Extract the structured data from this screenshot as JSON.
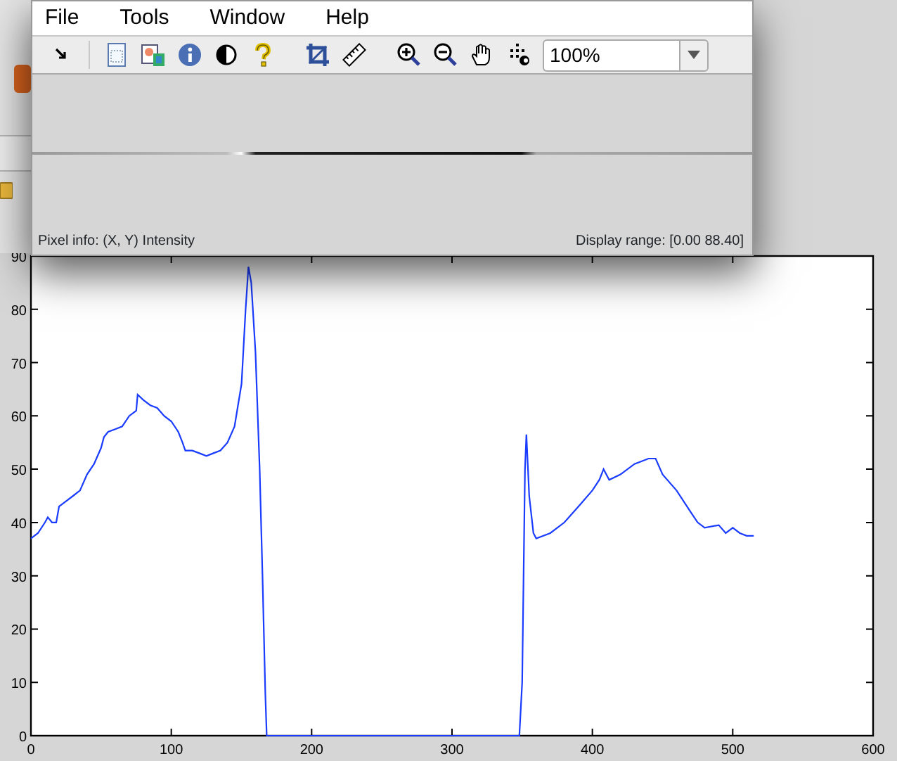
{
  "image_tool": {
    "menu": [
      "File",
      "Tools",
      "Window",
      "Help"
    ],
    "magnification": "100%",
    "status_left": "Pixel info: (X, Y)  Intensity",
    "status_right": "Display range: [0.00 88.40]"
  },
  "plot": {
    "chart_data": {
      "type": "line",
      "xlim": [
        0,
        600
      ],
      "ylim": [
        0,
        90
      ],
      "xticks": [
        0,
        100,
        200,
        300,
        400,
        500,
        600
      ],
      "yticks": [
        0,
        10,
        20,
        30,
        40,
        50,
        60,
        70,
        80,
        90
      ],
      "x": [
        0,
        5,
        10,
        12,
        15,
        18,
        20,
        25,
        30,
        35,
        40,
        45,
        50,
        52,
        55,
        60,
        65,
        70,
        75,
        76,
        80,
        85,
        90,
        95,
        100,
        105,
        108,
        110,
        115,
        120,
        125,
        130,
        135,
        140,
        145,
        150,
        153,
        155,
        157,
        160,
        163,
        165,
        167,
        168,
        348,
        350,
        351,
        352,
        353,
        355,
        358,
        360,
        370,
        380,
        390,
        400,
        405,
        408,
        412,
        420,
        430,
        440,
        445,
        450,
        460,
        470,
        475,
        480,
        490,
        495,
        500,
        505,
        510,
        515
      ],
      "series": [
        {
          "color": "#1a3cff",
          "values": [
            37,
            38,
            40,
            41,
            40,
            40,
            43,
            44,
            45,
            46,
            49,
            51,
            54,
            56,
            57,
            57.5,
            58,
            60,
            61,
            64,
            63,
            62,
            61.5,
            60,
            59,
            57,
            55,
            53.5,
            53.5,
            53,
            52.5,
            53,
            53.5,
            55,
            58,
            66,
            80,
            88,
            85,
            72,
            50,
            30,
            8,
            0,
            0,
            10,
            30,
            50,
            56.5,
            45,
            38,
            37,
            38,
            40,
            43,
            46,
            48,
            50,
            48,
            49,
            51,
            52,
            52,
            49,
            46,
            42,
            40,
            39,
            39.5,
            38,
            39,
            38,
            37.5,
            37.5
          ]
        }
      ]
    }
  }
}
